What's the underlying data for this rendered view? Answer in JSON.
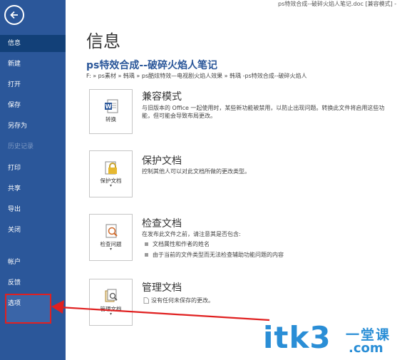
{
  "window": {
    "title": "ps特效合成--破碎火焰人笔记.doc [兼容模式] -"
  },
  "sidebar": {
    "items": [
      {
        "label": "信息"
      },
      {
        "label": "新建"
      },
      {
        "label": "打开"
      },
      {
        "label": "保存"
      },
      {
        "label": "另存为"
      },
      {
        "label": "历史记录"
      },
      {
        "label": "打印"
      },
      {
        "label": "共享"
      },
      {
        "label": "导出"
      },
      {
        "label": "关闭"
      },
      {
        "label": "帐户"
      },
      {
        "label": "反馈"
      },
      {
        "label": "选项"
      }
    ]
  },
  "main": {
    "page_title": "信息",
    "doc_title": "ps特效合成--破碎火焰人笔记",
    "doc_path": "F: » ps素材 » 韩瑀  » ps酷炫特效—电视剧火焰人效果 » 韩瑀   -ps特效合成--破碎火焰人",
    "sections": [
      {
        "button_label": "转换",
        "title": "兼容模式",
        "description": "与旧版本的 Office 一起使用时，某些新功能被禁用，以防止出现问题。转换此文件将启用这些功能，但可能会导致布局更改。"
      },
      {
        "button_label": "保护文档",
        "title": "保护文档",
        "description": "控制其他人可以对此文档所做的更改类型。"
      },
      {
        "button_label": "检查问题",
        "title": "检查文档",
        "description": "在发布此文件之前，请注意其是否包含:",
        "bullets": [
          "文档属性和作者的姓名",
          "由于当前的文件类型而无法检查辅助功能问题的内容"
        ]
      },
      {
        "button_label": "管理文档",
        "title": "管理文档",
        "description": "没有任何未保存的更改。"
      }
    ]
  },
  "watermark": {
    "main": "itk3",
    "sub1": "一堂课",
    "sub2": ".com"
  },
  "colors": {
    "sidebar": "#2b579a",
    "accent": "#2b579a",
    "highlight": "#e02020"
  }
}
